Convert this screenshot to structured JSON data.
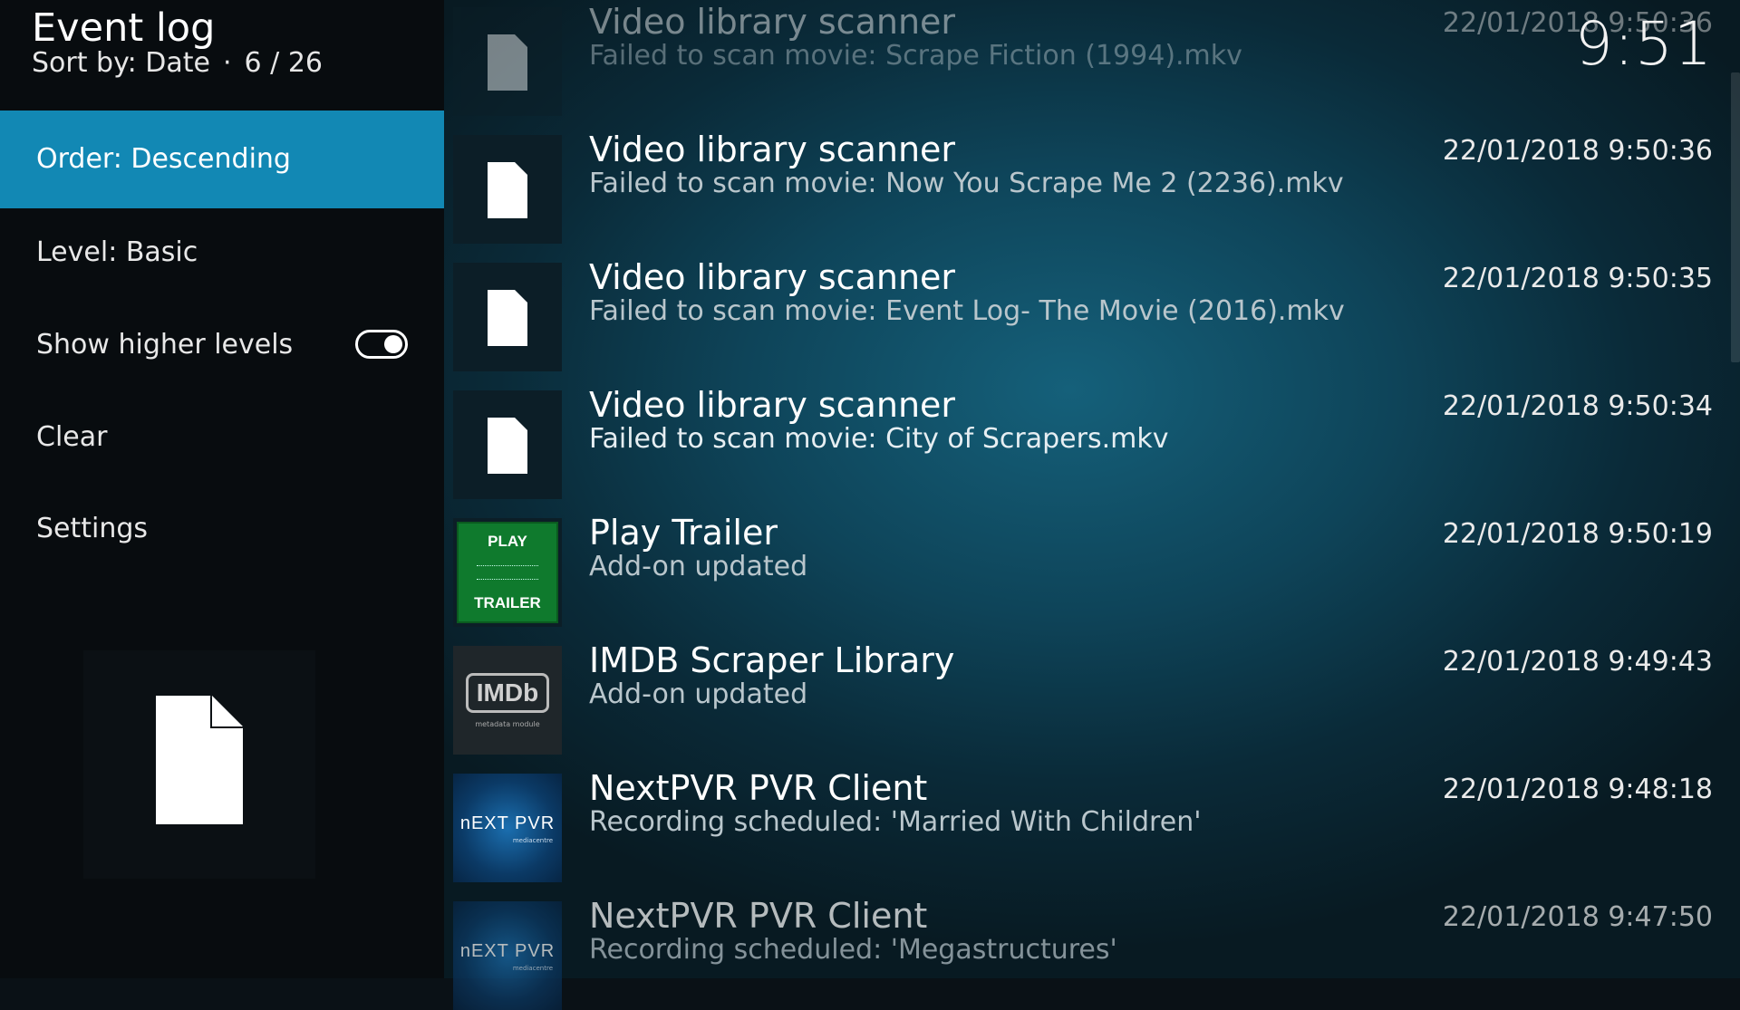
{
  "header": {
    "title": "Event log",
    "sort_label": "Sort by: Date",
    "separator": "·",
    "position": "6 / 26",
    "clock": "9:51"
  },
  "sidebar": {
    "items": [
      {
        "label": "Order: Descending",
        "active": true
      },
      {
        "label": "Level: Basic"
      },
      {
        "label": "Show higher levels",
        "toggle": true,
        "toggle_on": true
      },
      {
        "label": "Clear"
      },
      {
        "label": "Settings"
      }
    ],
    "preview_icon": "file-icon"
  },
  "events": [
    {
      "title": "Video library scanner",
      "description": "Failed to scan movie: Scrape Fiction (1994).mkv",
      "time": "22/01/2018 9:50:36",
      "icon": "file-icon"
    },
    {
      "title": "Video library scanner",
      "description": "Failed to scan movie: Now You Scrape Me 2 (2236).mkv",
      "time": "22/01/2018 9:50:36",
      "icon": "file-icon"
    },
    {
      "title": "Video library scanner",
      "description": "Failed to scan movie: Event Log- The Movie (2016).mkv",
      "time": "22/01/2018 9:50:35",
      "icon": "file-icon"
    },
    {
      "title": "Video library scanner",
      "description": "Failed to scan movie: City of Scrapers.mkv",
      "time": "22/01/2018 9:50:34",
      "icon": "file-icon"
    },
    {
      "title": "Play Trailer",
      "description": "Add-on updated",
      "time": "22/01/2018 9:50:19",
      "icon": "play-trailer-logo",
      "thumb_top": "PLAY",
      "thumb_bottom": "TRAILER"
    },
    {
      "title": "IMDB Scraper Library",
      "description": "Add-on updated",
      "time": "22/01/2018 9:49:43",
      "icon": "imdb-logo",
      "thumb_text": "IMDb",
      "thumb_sub": "metadata module"
    },
    {
      "title": "NextPVR PVR Client",
      "description": "Recording scheduled: 'Married With Children'",
      "time": "22/01/2018 9:48:18",
      "icon": "nextpvr-logo",
      "thumb_text": "nEXT PVR",
      "thumb_sub": "mediacentre"
    },
    {
      "title": "NextPVR PVR Client",
      "description": "Recording scheduled: 'Megastructures'",
      "time": "22/01/2018 9:47:50",
      "icon": "nextpvr-logo",
      "thumb_text": "nEXT PVR",
      "thumb_sub": "mediacentre"
    }
  ],
  "colors": {
    "accent": "#1288b4",
    "sidebar_bg": "#080c0f",
    "play_trailer_green": "#0f7a2d"
  }
}
